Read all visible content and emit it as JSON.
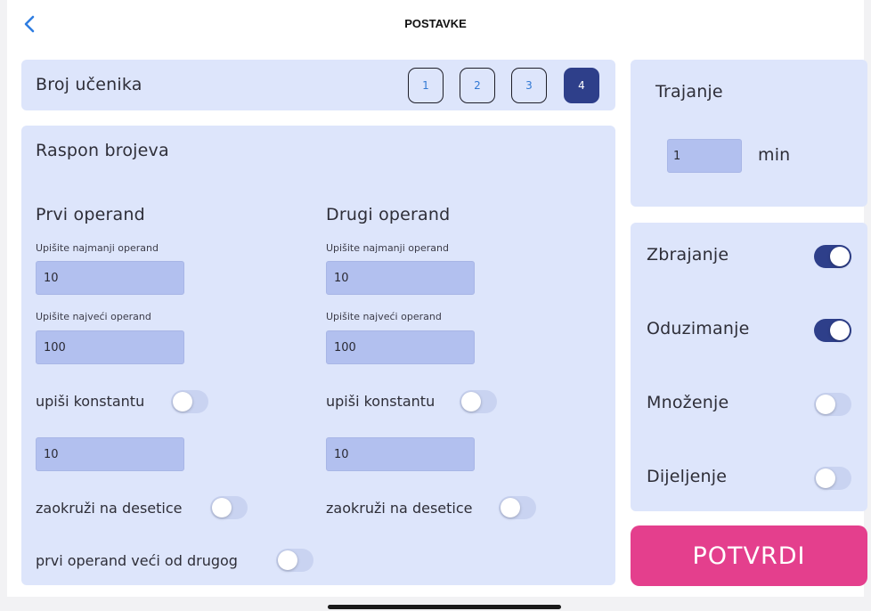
{
  "header": {
    "title": "POSTAVKE",
    "back_icon": "chevron-left-icon"
  },
  "students": {
    "label": "Broj učenika",
    "options": [
      "1",
      "2",
      "3",
      "4"
    ],
    "selected": "4"
  },
  "range": {
    "title": "Raspon brojeva",
    "first": {
      "title": "Prvi operand",
      "min_label": "Upišite najmanji operand",
      "min_value": "10",
      "max_label": "Upišite najveći operand",
      "max_value": "100",
      "constant_label": "upiši konstantu",
      "constant_on": false,
      "constant_value": "10",
      "round_label": "zaokruži na desetice",
      "round_on": false
    },
    "second": {
      "title": "Drugi operand",
      "min_label": "Upišite najmanji operand",
      "min_value": "10",
      "max_label": "Upišite najveći operand",
      "max_value": "100",
      "constant_label": "upiši konstantu",
      "constant_on": false,
      "constant_value": "10",
      "round_label": "zaokruži na desetice",
      "round_on": false
    },
    "first_greater_label": "prvi operand veći od drugog",
    "first_greater_on": false
  },
  "duration": {
    "title": "Trajanje",
    "value": "1",
    "unit": "min"
  },
  "operations": [
    {
      "label": "Zbrajanje",
      "on": true
    },
    {
      "label": "Oduzimanje",
      "on": true
    },
    {
      "label": "Množenje",
      "on": false
    },
    {
      "label": "Dijeljenje",
      "on": false
    }
  ],
  "confirm_label": "POTVRDI",
  "colors": {
    "accent": "#2e3f8a",
    "panel": "#dde5fb",
    "field": "#b2c0ef",
    "confirm": "#e43f8d",
    "link": "#3279d4"
  }
}
